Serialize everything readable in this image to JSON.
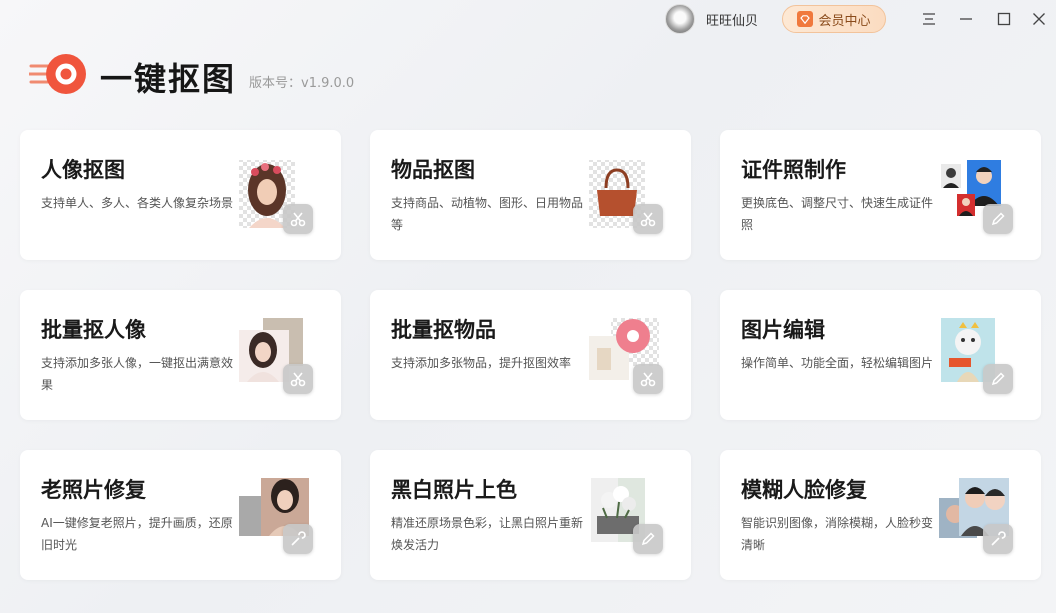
{
  "header": {
    "username": "旺旺仙贝",
    "vip_label": "会员中心",
    "app_title": "一键抠图",
    "version": "版本号：v1.9.0.0"
  },
  "window_controls": [
    "menu-icon",
    "minimize-icon",
    "maximize-icon",
    "close-icon"
  ],
  "colors": {
    "brand": "#f0553d",
    "vip_text": "#8a4b1b"
  },
  "cards": [
    {
      "title": "人像抠图",
      "desc": "支持单人、多人、各类人像复杂场景",
      "icon": "scissors-icon"
    },
    {
      "title": "物品抠图",
      "desc": "支持商品、动植物、图形、日用物品等",
      "icon": "scissors-icon"
    },
    {
      "title": "证件照制作",
      "desc": "更换底色、调整尺寸、快速生成证件照",
      "icon": "pencil-icon"
    },
    {
      "title": "批量抠人像",
      "desc": "支持添加多张人像，一键抠出满意效果",
      "icon": "scissors-icon"
    },
    {
      "title": "批量抠物品",
      "desc": "支持添加多张物品，提升抠图效率",
      "icon": "scissors-icon"
    },
    {
      "title": "图片编辑",
      "desc": "操作简单、功能全面，轻松编辑图片",
      "icon": "pencil-icon"
    },
    {
      "title": "老照片修复",
      "desc": "AI一键修复老照片，提升画质，还原旧时光",
      "icon": "wrench-icon"
    },
    {
      "title": "黑白照片上色",
      "desc": "精准还原场景色彩，让黑白照片重新焕发活力",
      "icon": "pencil-icon"
    },
    {
      "title": "模糊人脸修复",
      "desc": "智能识别图像，消除模糊，人脸秒变清晰",
      "icon": "wrench-icon"
    }
  ]
}
